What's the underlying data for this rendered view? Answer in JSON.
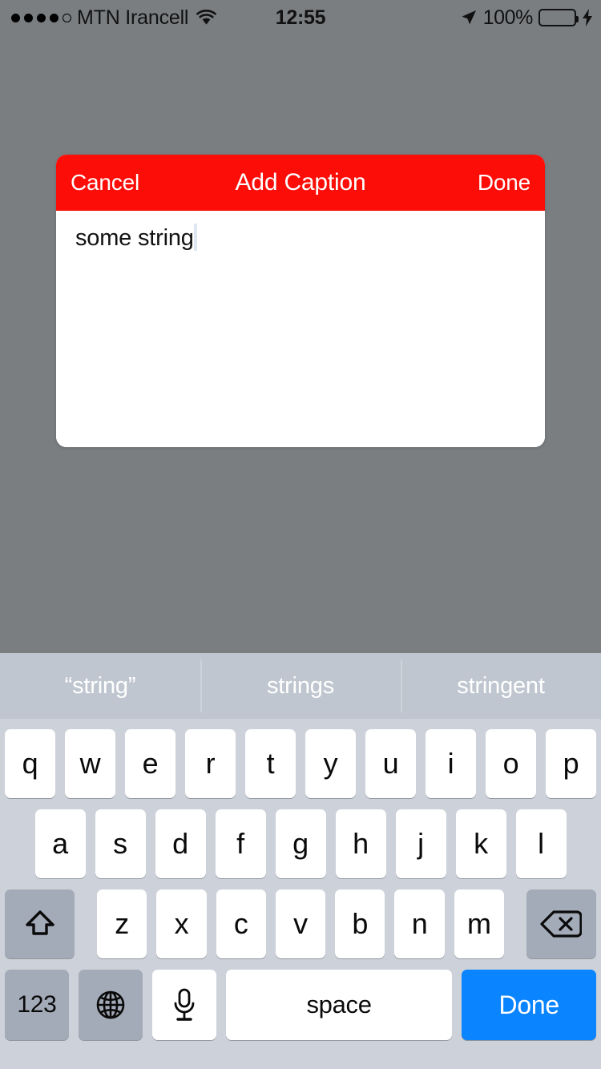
{
  "status_bar": {
    "signal_dots_filled": 4,
    "signal_dots_total": 5,
    "carrier": "MTN Irancell",
    "wifi_icon": "wifi-icon",
    "time": "12:55",
    "location_icon": "location-arrow-icon",
    "battery_percent": "100%",
    "battery_color": "#4cd964",
    "charging_icon": "lightning-bolt-icon"
  },
  "caption_modal": {
    "cancel_label": "Cancel",
    "title": "Add Caption",
    "done_label": "Done",
    "header_color": "#fc0d07",
    "input_value": "some string",
    "input_placeholder": "",
    "caret_visible": true
  },
  "keyboard": {
    "suggestions": [
      "“string”",
      "strings",
      "stringent"
    ],
    "row1": [
      "q",
      "w",
      "e",
      "r",
      "t",
      "y",
      "u",
      "i",
      "o",
      "p"
    ],
    "row2": [
      "a",
      "s",
      "d",
      "f",
      "g",
      "h",
      "j",
      "k",
      "l"
    ],
    "row3": [
      "z",
      "x",
      "c",
      "v",
      "b",
      "n",
      "m"
    ],
    "shift_icon": "shift-arrow-icon",
    "backspace_icon": "backspace-delete-icon",
    "numbers_label": "123",
    "globe_icon": "globe-icon",
    "mic_icon": "microphone-icon",
    "space_label": "space",
    "return_label": "Done",
    "return_color": "#0a84ff",
    "background_color": "#cdd1d9",
    "suggestion_bar_color": "#bfc6cf"
  },
  "background_color": "#7b7e81"
}
